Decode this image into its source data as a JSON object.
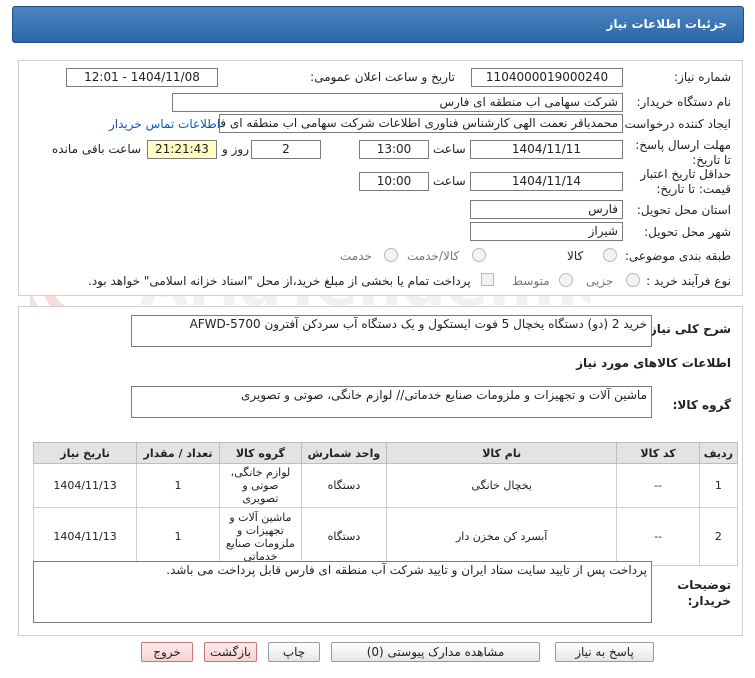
{
  "header": {
    "title": "جزئیات اطلاعات نیاز"
  },
  "form": {
    "need_number": {
      "label": "شماره نیاز:",
      "value": "1104000019000240"
    },
    "announce_datetime": {
      "label": "تاریخ و ساعت اعلان عمومی:",
      "value": "1404/11/08 - 12:01"
    },
    "buyer_org": {
      "label": "نام دستگاه خریدار:",
      "value": "شرکت سهامی اب منطقه ای فارس"
    },
    "requester": {
      "label": "ایجاد کننده درخواست:",
      "value": "محمدباقر نعمت الهی کارشناس فناوری اطلاعات شرکت سهامی اب منطقه ای فارس",
      "contact_link": "اطلاعات تماس خریدار"
    },
    "reply_deadline": {
      "label": "مهلت ارسال پاسخ: تا تاریخ:",
      "date": "1404/11/11",
      "time_label": "ساعت",
      "time": "13:00",
      "days": "2",
      "days_label": "روز و",
      "remaining": "21:21:43",
      "remaining_label": "ساعت باقی مانده"
    },
    "price_validity": {
      "label": "حداقل تاریخ اعتبار قیمت: تا تاریخ:",
      "date": "1404/11/14",
      "time_label": "ساعت",
      "time": "10:00"
    },
    "province": {
      "label": "استان محل تحویل:",
      "value": "فارس"
    },
    "city": {
      "label": "شهر محل تحویل:",
      "value": "شیراز"
    },
    "category": {
      "label": "طبقه بندی موضوعی:",
      "options": [
        "کالا",
        "کالا/خدمت",
        "خدمت"
      ]
    },
    "process_type": {
      "label": "نوع فرآیند خرید :",
      "options": [
        "جزیی",
        "متوسط"
      ],
      "payment_note": "پرداخت تمام یا بخشی از مبلغ خرید،از محل \"اسناد خزانه اسلامی\" خواهد بود."
    }
  },
  "general_description": {
    "label": "شرح کلی نیاز:",
    "value": "خرید 2 (دو) دستگاه یخچال 5 فوت ایستکول و یک دستگاه آب سردکن آفترون  AFWD-5700"
  },
  "goods_info": {
    "title": "اطلاعات کالاهای مورد نیاز",
    "group_label": "گروه کالا:",
    "group_value": "ماشین آلات و تجهیزات و ملزومات صنایع خدماتی// لوازم خانگی، صوتی و تصویری"
  },
  "table": {
    "headers": [
      "ردیف",
      "کد کالا",
      "نام کالا",
      "واحد شمارش",
      "گروه کالا",
      "تعداد / مقدار",
      "تاریخ نیاز"
    ],
    "rows": [
      [
        "1",
        "--",
        "یخچال خانگی",
        "دستگاه",
        "لوازم خانگی، صوتی و تصویری",
        "1",
        "1404/11/13"
      ],
      [
        "2",
        "--",
        "آبسرد کن مخزن دار",
        "دستگاه",
        "ماشین آلات و تجهیزات و ملزومات صنایع خدماتی",
        "1",
        "1404/11/13"
      ]
    ]
  },
  "buyer_notes": {
    "label": "توضیحات خریدار:",
    "value": "پرداخت پس از تایید سایت ستاد ایران و تایید شرکت آب منطقه ای فارس قابل پرداخت می باشد."
  },
  "buttons": {
    "reply": "پاسخ به نیاز",
    "attachments": "مشاهده مدارک پیوستی (0)",
    "print": "چاپ",
    "back": "بازگشت",
    "exit": "خروج"
  },
  "watermark": {
    "text": "AriaTender.neT"
  }
}
